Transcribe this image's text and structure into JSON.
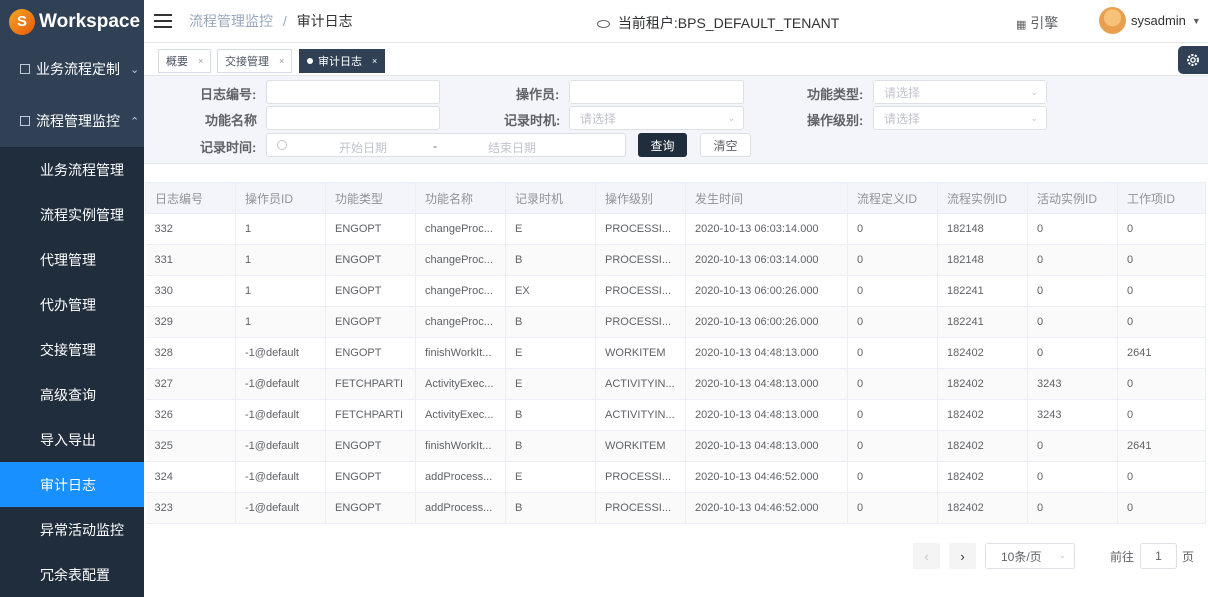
{
  "app": {
    "logo_letter": "S",
    "logo_text": "Workspace"
  },
  "sidebar": {
    "groups": [
      {
        "label": "业务流程定制",
        "chevron": "chevron-down-icon"
      },
      {
        "label": "流程管理监控",
        "chevron": "chevron-up-icon"
      }
    ],
    "items": [
      {
        "label": "业务流程管理"
      },
      {
        "label": "流程实例管理"
      },
      {
        "label": "代理管理"
      },
      {
        "label": "代办管理"
      },
      {
        "label": "交接管理"
      },
      {
        "label": "高级查询"
      },
      {
        "label": "导入导出"
      },
      {
        "label": "审计日志",
        "active": true
      },
      {
        "label": "异常活动监控"
      },
      {
        "label": "冗余表配置"
      }
    ]
  },
  "header": {
    "breadcrumb": [
      "流程管理监控",
      "审计日志"
    ],
    "breadcrumb_sep": "/",
    "tenant": "当前租户:BPS_DEFAULT_TENANT",
    "engine": "引擎",
    "user": "sysadmin"
  },
  "tabs": [
    {
      "label": "概要",
      "close": "×"
    },
    {
      "label": "交接管理",
      "close": "×"
    },
    {
      "label": "审计日志",
      "close": "×",
      "active": true
    }
  ],
  "filter": {
    "log_id_label": "日志编号:",
    "operator_label": "操作员:",
    "func_type_label": "功能类型:",
    "func_name_label": "功能名称",
    "record_timing_label": "记录时机:",
    "op_level_label": "操作级别:",
    "record_time_label": "记录时间:",
    "select_placeholder": "请选择",
    "start_date_placeholder": "开始日期",
    "date_sep": "-",
    "end_date_placeholder": "结束日期",
    "query_button": "查询",
    "clear_button": "清空"
  },
  "table": {
    "columns": [
      "日志编号",
      "操作员ID",
      "功能类型",
      "功能名称",
      "记录时机",
      "操作级别",
      "发生时间",
      "流程定义ID",
      "流程实例ID",
      "活动实例ID",
      "工作项ID"
    ],
    "rows": [
      [
        "332",
        "1",
        "ENGOPT",
        "changeProc...",
        "E",
        "PROCESSI...",
        "2020-10-13 06:03:14.000",
        "0",
        "182148",
        "0",
        "0"
      ],
      [
        "331",
        "1",
        "ENGOPT",
        "changeProc...",
        "B",
        "PROCESSI...",
        "2020-10-13 06:03:14.000",
        "0",
        "182148",
        "0",
        "0"
      ],
      [
        "330",
        "1",
        "ENGOPT",
        "changeProc...",
        "EX",
        "PROCESSI...",
        "2020-10-13 06:00:26.000",
        "0",
        "182241",
        "0",
        "0"
      ],
      [
        "329",
        "1",
        "ENGOPT",
        "changeProc...",
        "B",
        "PROCESSI...",
        "2020-10-13 06:00:26.000",
        "0",
        "182241",
        "0",
        "0"
      ],
      [
        "328",
        "-1@default",
        "ENGOPT",
        "finishWorkIt...",
        "E",
        "WORKITEM",
        "2020-10-13 04:48:13.000",
        "0",
        "182402",
        "0",
        "2641"
      ],
      [
        "327",
        "-1@default",
        "FETCHPARTI",
        "ActivityExec...",
        "E",
        "ACTIVITYIN...",
        "2020-10-13 04:48:13.000",
        "0",
        "182402",
        "3243",
        "0"
      ],
      [
        "326",
        "-1@default",
        "FETCHPARTI",
        "ActivityExec...",
        "B",
        "ACTIVITYIN...",
        "2020-10-13 04:48:13.000",
        "0",
        "182402",
        "3243",
        "0"
      ],
      [
        "325",
        "-1@default",
        "ENGOPT",
        "finishWorkIt...",
        "B",
        "WORKITEM",
        "2020-10-13 04:48:13.000",
        "0",
        "182402",
        "0",
        "2641"
      ],
      [
        "324",
        "-1@default",
        "ENGOPT",
        "addProcess...",
        "E",
        "PROCESSI...",
        "2020-10-13 04:46:52.000",
        "0",
        "182402",
        "0",
        "0"
      ],
      [
        "323",
        "-1@default",
        "ENGOPT",
        "addProcess...",
        "B",
        "PROCESSI...",
        "2020-10-13 04:46:52.000",
        "0",
        "182402",
        "0",
        "0"
      ]
    ]
  },
  "pagination": {
    "prev": "‹",
    "next": "›",
    "page_size": "10条/页",
    "goto_label": "前往",
    "goto_value": "1",
    "page_suffix": "页"
  }
}
